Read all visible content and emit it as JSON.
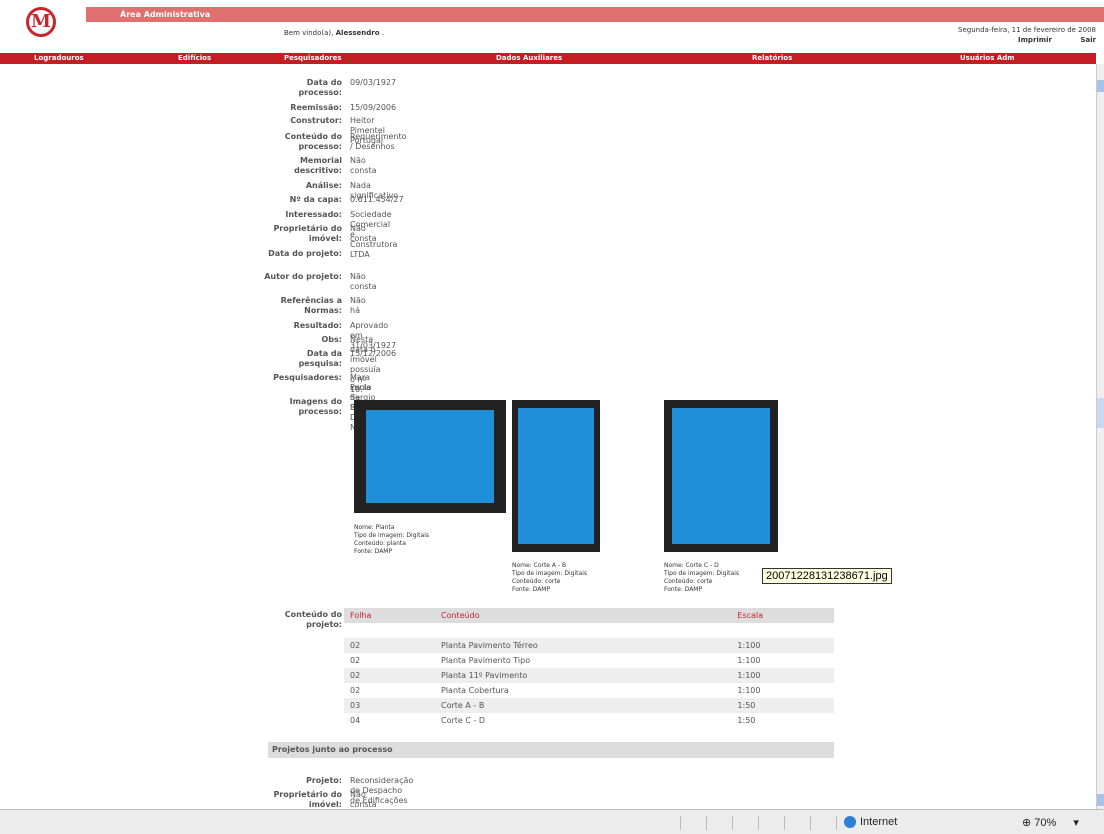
{
  "header": {
    "logo_letter": "M",
    "admin_title": "Área Administrativa",
    "welcome_prefix": "Bem vindo(a),",
    "welcome_user": "Alessendro",
    "welcome_suffix": ".",
    "date": "Segunda-feira, 11 de fevereiro de 2008",
    "print_label": "Imprimir",
    "logout_label": "Sair"
  },
  "menu": [
    "Logradouros",
    "Edifícios",
    "Pesquisadores",
    "Dados Auxiliares",
    "Relatórios",
    "Usuários Adm"
  ],
  "fields": [
    {
      "label": "Data do processo:",
      "value": "09/03/1927"
    },
    {
      "label": "Reemissão:",
      "value": "15/09/2006"
    },
    {
      "label": "Construtor:",
      "value": "Heitor Pimentel Portugal"
    },
    {
      "label": "Conteúdo do processo:",
      "value": "Requerimento / Desenhos"
    },
    {
      "label": "Memorial descritivo:",
      "value": "Não consta"
    },
    {
      "label": "Análise:",
      "value": "Nada significativo"
    },
    {
      "label": "Nº da capa:",
      "value": "0.011.454/27"
    },
    {
      "label": "Interessado:",
      "value": "Sociedade Comercial e Construtora LTDA"
    },
    {
      "label": "Proprietário do imóvel:",
      "value": "Não consta"
    },
    {
      "label": "Data do projeto:",
      "value": ""
    },
    {
      "label": "Autor do projeto:",
      "value": "Não consta"
    },
    {
      "label": "Referências a Normas:",
      "value": "Não há"
    },
    {
      "label": "Resultado:",
      "value": "Aprovado em 31/03/1927"
    },
    {
      "label": "Obs:",
      "value": "Nesta data o imóvel possuía o nº 10."
    },
    {
      "label": "Data da pesquisa:",
      "value": "15/12/2006"
    },
    {
      "label": "Pesquisadores:",
      "value": "Mara Lucia da Silva"
    },
    {
      "label": "",
      "value": "Paulo Sergio Bárbaro Del Negro"
    }
  ],
  "images_label": "Imagens do processo:",
  "images": [
    {
      "nome": "Nome: Planta",
      "tipo": "Tipo de imagem: Digitais",
      "conteudo": "Conteúdo: planta",
      "fonte": "Fonte: DAMP"
    },
    {
      "nome": "Nome: Corte A - B",
      "tipo": "Tipo de imagem: Digitais",
      "conteudo": "Conteúdo: corte",
      "fonte": "Fonte: DAMP"
    },
    {
      "nome": "Nome: Corte C - D",
      "tipo": "Tipo de imagem: Digitais",
      "conteudo": "Conteúdo: corte",
      "fonte": "Fonte: DAMP"
    }
  ],
  "tooltip": "20071228131238671.jpg",
  "project_content_label": "Conteúdo do projeto:",
  "table": {
    "headers": [
      "Folha",
      "Conteúdo",
      "Escala"
    ],
    "rows": [
      [
        "02",
        "Planta Pavimento Térreo",
        "1:100"
      ],
      [
        "02",
        "Planta Pavimento Tipo",
        "1:100"
      ],
      [
        "02",
        "Planta 11º Pavimento",
        "1:100"
      ],
      [
        "02",
        "Planta Cobertura",
        "1:100"
      ],
      [
        "03",
        "Corte A - B",
        "1:50"
      ],
      [
        "04",
        "Corte C - D",
        "1:50"
      ]
    ]
  },
  "related_section": "Projetos junto ao processo",
  "related_fields": [
    {
      "label": "Projeto:",
      "value": "Reconsideração de Despacho de Edificações"
    },
    {
      "label": "Proprietário do imóvel:",
      "value": "Não consta"
    }
  ],
  "statusbar": {
    "zone": "Internet",
    "zoom": "70%"
  }
}
